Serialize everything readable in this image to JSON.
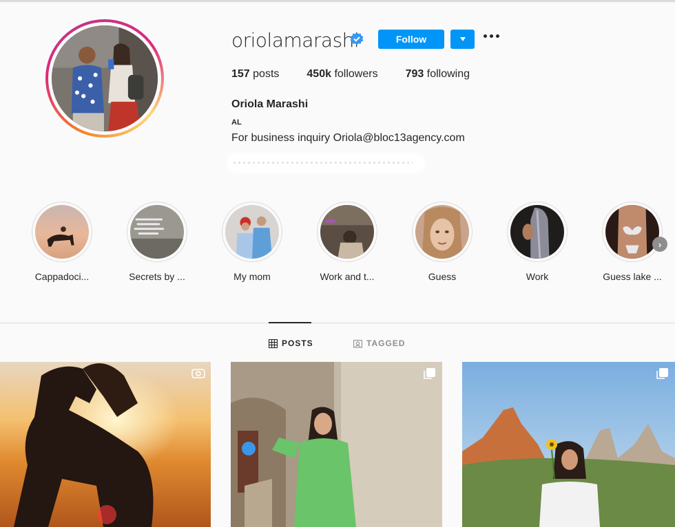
{
  "profile": {
    "username": "oriolamarashi",
    "verified": true,
    "follow_label": "Follow",
    "stats": {
      "posts_count": "157",
      "posts_label": "posts",
      "followers_count": "450k",
      "followers_label": "followers",
      "following_count": "793",
      "following_label": "following"
    },
    "full_name": "Oriola Marashi",
    "category": "AL",
    "bio": "For business inquiry Oriola@bloc13agency.com"
  },
  "highlights": [
    {
      "label": "Cappadoci..."
    },
    {
      "label": "Secrets by ..."
    },
    {
      "label": "My mom"
    },
    {
      "label": "Work and t..."
    },
    {
      "label": "Guess"
    },
    {
      "label": "Work"
    },
    {
      "label": "Guess lake ..."
    }
  ],
  "tabs": {
    "posts": "POSTS",
    "tagged": "TAGGED"
  },
  "icons": {
    "verified": "verified-badge-icon",
    "more": "more-options-icon",
    "dropdown": "chevron-down-icon",
    "posts_tab": "grid-icon",
    "tagged_tab": "tag-icon",
    "video": "video-icon",
    "carousel": "carousel-icon",
    "next": "chevron-right-icon"
  },
  "colors": {
    "accent": "#0095f6",
    "text": "#262626",
    "muted": "#8e8e8e",
    "border": "#dbdbdb",
    "background": "#fafafa"
  }
}
